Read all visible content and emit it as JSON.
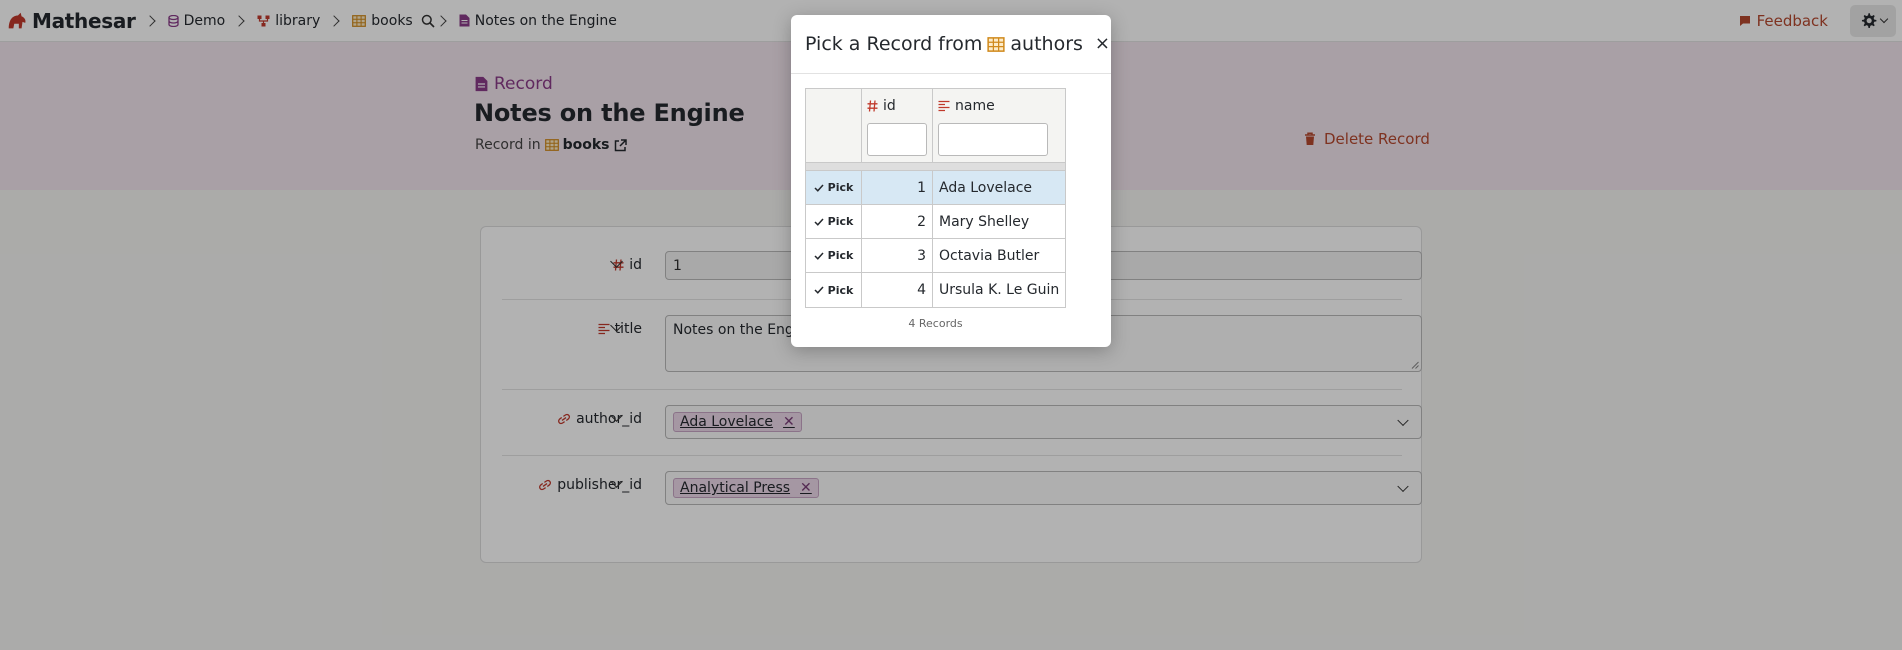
{
  "app": {
    "name": "Mathesar"
  },
  "breadcrumb": {
    "database": "Demo",
    "schema": "library",
    "table": "books",
    "record": "Notes on the Engine"
  },
  "header": {
    "feedback_label": "Feedback"
  },
  "record": {
    "kind_label": "Record",
    "title": "Notes on the Engine",
    "in_prefix": "Record in",
    "table_name": "books",
    "delete_label": "Delete Record"
  },
  "form": {
    "fields": [
      {
        "label": "id",
        "value": "1"
      },
      {
        "label": "title",
        "value": "Notes on the Engine"
      },
      {
        "label": "author_id",
        "value": "Ada Lovelace"
      },
      {
        "label": "publisher_id",
        "value": "Analytical Press"
      }
    ]
  },
  "modal": {
    "title_prefix": "Pick a Record from",
    "table_name": "authors",
    "close_glyph": "×",
    "columns": [
      "id",
      "name"
    ],
    "pick_label": "Pick",
    "rows": [
      {
        "id": "1",
        "name": "Ada Lovelace",
        "selected": true
      },
      {
        "id": "2",
        "name": "Mary Shelley"
      },
      {
        "id": "3",
        "name": "Octavia Butler"
      },
      {
        "id": "4",
        "name": "Ursula K. Le Guin"
      }
    ],
    "record_count": "4 Records"
  },
  "colors": {
    "brand_purple": "#8a3b88",
    "danger": "#b5482f",
    "selected_row": "#d7e8f4",
    "band": "#f3e6ee"
  }
}
